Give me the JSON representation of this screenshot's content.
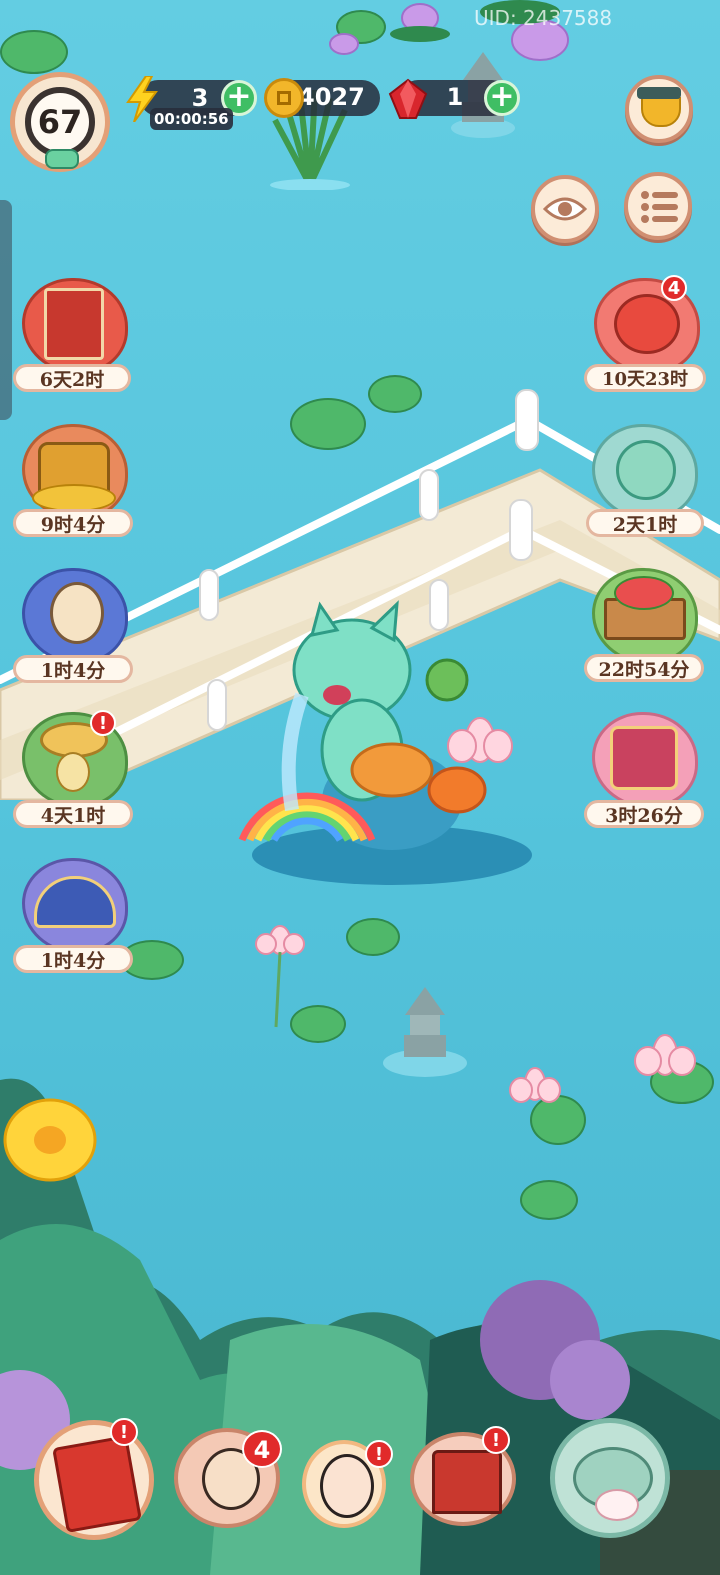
{
  "uid_text": "UID: 2437588",
  "level": "67",
  "energy": {
    "value": "3",
    "timer": "00:00:56"
  },
  "coins": {
    "value": "4027"
  },
  "gems": {
    "value": "1"
  },
  "left_events": [
    {
      "name": "almanac-event",
      "label": "6天2时"
    },
    {
      "name": "treasure-chest-event",
      "label": "9时4分"
    },
    {
      "name": "cat-flower-event",
      "label": "1时4分"
    },
    {
      "name": "straw-hat-bird-event",
      "label": "4天1时",
      "alert": "!"
    },
    {
      "name": "bird-fan-event",
      "label": "1时4分"
    }
  ],
  "right_events": [
    {
      "name": "red-cat-event",
      "label": "10天23时",
      "badge": "4"
    },
    {
      "name": "jade-cat-event",
      "label": "2天1时"
    },
    {
      "name": "vegetable-cart-event",
      "label": "22时54分"
    },
    {
      "name": "gift-box-event",
      "label": "3时26分"
    }
  ],
  "dock": {
    "book_alert": "!",
    "character_badge": "4",
    "lady_alert": "!",
    "shop_alert": "!"
  },
  "colors": {
    "water": "#59c7dd",
    "alert_red": "#e12a2a",
    "plus_green": "#3fbe64",
    "coin_gold": "#f2b62a",
    "gem_red": "#d8262d"
  }
}
